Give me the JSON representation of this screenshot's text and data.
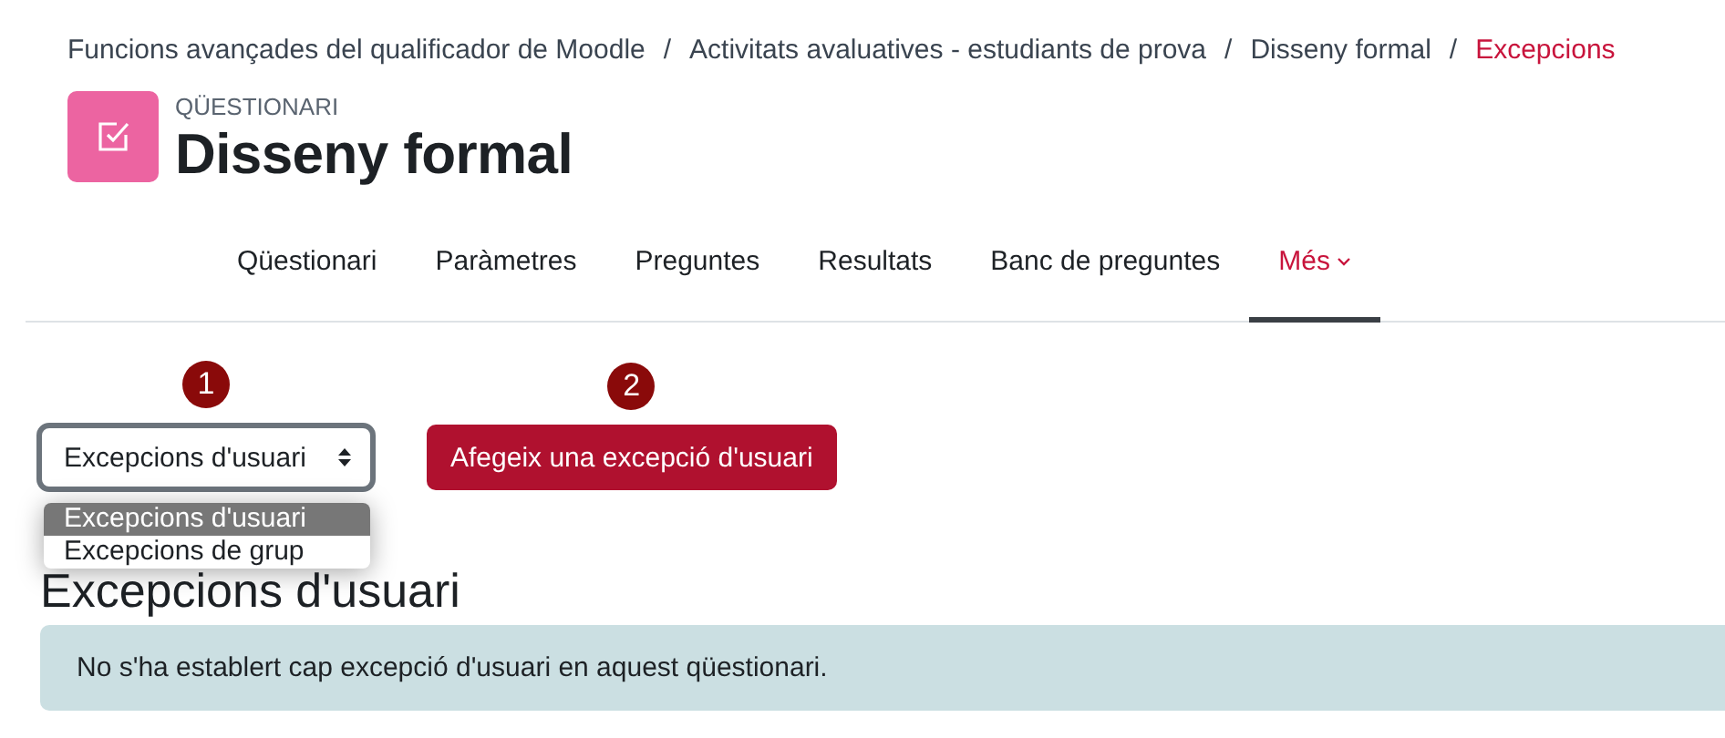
{
  "breadcrumb": [
    {
      "label": "Funcions avançades del qualificador de Moodle",
      "current": false
    },
    {
      "label": "Activitats avaluatives - estudiants de prova",
      "current": false
    },
    {
      "label": "Disseny formal",
      "current": false
    },
    {
      "label": "Excepcions",
      "current": true
    }
  ],
  "breadcrumb_separator": "/",
  "activity": {
    "type": "QÜESTIONARI",
    "title": "Disseny formal"
  },
  "tabs": [
    {
      "label": "Qüestionari",
      "selected": false,
      "kind": "link"
    },
    {
      "label": "Paràmetres",
      "selected": false,
      "kind": "link"
    },
    {
      "label": "Preguntes",
      "selected": false,
      "kind": "link"
    },
    {
      "label": "Resultats",
      "selected": false,
      "kind": "link"
    },
    {
      "label": "Banc de preguntes",
      "selected": false,
      "kind": "link"
    },
    {
      "label": "Més",
      "selected": true,
      "kind": "menu"
    }
  ],
  "select": {
    "marker": "1",
    "value": "Excepcions d'usuari",
    "expanded": true,
    "options": [
      {
        "label": "Excepcions d'usuari",
        "selected": true
      },
      {
        "label": "Excepcions de grup",
        "selected": false
      }
    ]
  },
  "add_button": {
    "marker": "2",
    "label": "Afegeix una excepció d'usuari"
  },
  "heading": "Excepcions d'usuari",
  "alert": "No s'ha establert cap excepció d'usuari en aquest qüestionari."
}
